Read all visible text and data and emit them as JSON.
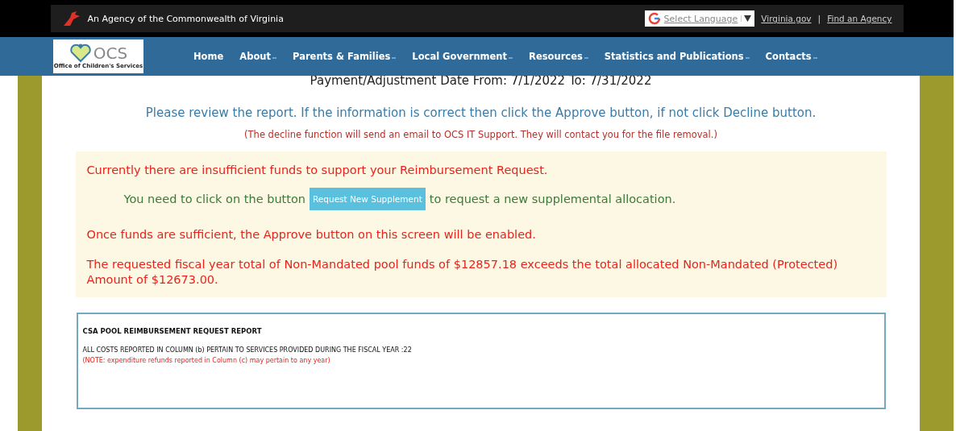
{
  "top_bar": {
    "agency": "An Agency of the Commonwealth of Virginia",
    "language_select": {
      "placeholder": "Select Language"
    },
    "links": [
      "Virginia.gov",
      "Find an Agency"
    ],
    "separator": "|"
  },
  "logo": {
    "name": "OCS",
    "subtitle": "Office of Children's Services"
  },
  "nav": [
    {
      "label": "Home",
      "dropdown": false
    },
    {
      "label": "About",
      "dropdown": true
    },
    {
      "label": "Parents & Families",
      "dropdown": true
    },
    {
      "label": "Local Government",
      "dropdown": true
    },
    {
      "label": "Resources",
      "dropdown": true
    },
    {
      "label": "Statistics and Publications",
      "dropdown": true
    },
    {
      "label": "Contacts",
      "dropdown": true
    }
  ],
  "date_range": "Payment/Adjustment Date From: 7/1/2022 To: 7/31/2022",
  "instruction": "Please review the report. If the information is correct then click the Approve button, if not click Decline button.",
  "decline_note": "(The decline function will send an email to OCS IT Support. They will contact you for the file removal.)",
  "alert": {
    "headline": "Currently there are insufficient funds to support your Reimbursement Request.",
    "supplement_before": "You need to click on the button",
    "supplement_button": "Request New Supplement",
    "supplement_after": "to request a new supplemental allocation.",
    "enable_note": "Once funds are sufficient, the Approve button on this screen will be enabled.",
    "exceed_note": "The requested fiscal year total of Non-Mandated pool funds of $12857.18 exceeds the total allocated Non-Mandated (Protected) Amount of $12673.00."
  },
  "report": {
    "title": "CSA POOL REIMBURSEMENT REQUEST REPORT",
    "fiscal_line": "ALL COSTS REPORTED IN COLUMN (b) PERTAIN TO SERVICES PROVIDED DURING THE FISCAL YEAR :22",
    "note": "(NOTE: expenditure refunds reported in Column (c) may pertain to any year)"
  }
}
